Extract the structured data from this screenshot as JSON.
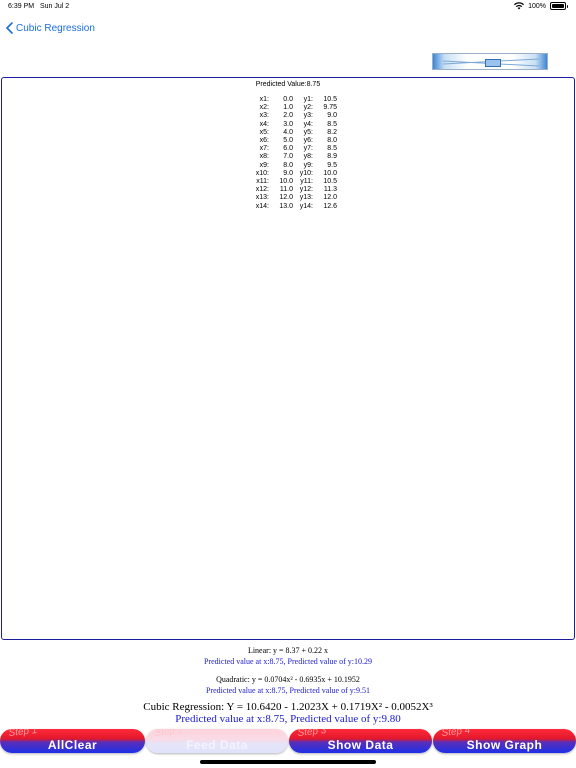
{
  "status_bar": {
    "time": "6:39 PM",
    "date": "Sun Jul 2",
    "battery": "100%"
  },
  "nav": {
    "back_label": "Cubic Regression"
  },
  "panel": {
    "predicted_label": "Predicted Value:8.75",
    "points": [
      {
        "xl": "x1:",
        "xv": "0.0",
        "yl": "y1:",
        "yv": "10.5"
      },
      {
        "xl": "x2:",
        "xv": "1.0",
        "yl": "y2:",
        "yv": "9.75"
      },
      {
        "xl": "x3:",
        "xv": "2.0",
        "yl": "y3:",
        "yv": "9.0"
      },
      {
        "xl": "x4:",
        "xv": "3.0",
        "yl": "y4:",
        "yv": "8.5"
      },
      {
        "xl": "x5:",
        "xv": "4.0",
        "yl": "y5:",
        "yv": "8.2"
      },
      {
        "xl": "x6:",
        "xv": "5.0",
        "yl": "y6:",
        "yv": "8.0"
      },
      {
        "xl": "x7:",
        "xv": "6.0",
        "yl": "y7:",
        "yv": "8.5"
      },
      {
        "xl": "x8:",
        "xv": "7.0",
        "yl": "y8:",
        "yv": "8.9"
      },
      {
        "xl": "x9:",
        "xv": "8.0",
        "yl": "y9:",
        "yv": "9.5"
      },
      {
        "xl": "x10:",
        "xv": "9.0",
        "yl": "y10:",
        "yv": "10.0"
      },
      {
        "xl": "x11:",
        "xv": "10.0",
        "yl": "y11:",
        "yv": "10.5"
      },
      {
        "xl": "x12:",
        "xv": "11.0",
        "yl": "y12:",
        "yv": "11.3"
      },
      {
        "xl": "x13:",
        "xv": "12.0",
        "yl": "y13:",
        "yv": "12.0"
      },
      {
        "xl": "x14:",
        "xv": "13.0",
        "yl": "y14:",
        "yv": "12.6"
      }
    ]
  },
  "results": {
    "linear_eq": "Linear: y = 8.37 + 0.22 x",
    "linear_pred": "Predicted value at x:8.75, Predicted value of y:10.29",
    "quadratic_eq": "Quadratic: y = 0.0704x² - 0.6935x + 10.1952",
    "quadratic_pred": "Predicted value at x:8.75, Predicted value of y:9.51",
    "cubic_eq": "Cubic Regression: Y = 10.6420 - 1.2023X + 0.1719X² - 0.0052X³",
    "cubic_pred": "Predicted value at x:8.75, Predicted value of y:9.80"
  },
  "buttons": [
    {
      "step": "Step 1",
      "label": "AllClear"
    },
    {
      "step": "Step 2",
      "label": "Feed Data"
    },
    {
      "step": "Step 3",
      "label": "Show Data"
    },
    {
      "step": "Step 4",
      "label": "Show Graph"
    }
  ],
  "colors": {
    "accent": "#1a6fe0",
    "result_blue": "#1a1ad0",
    "panel_border": "#1c1c9e"
  }
}
